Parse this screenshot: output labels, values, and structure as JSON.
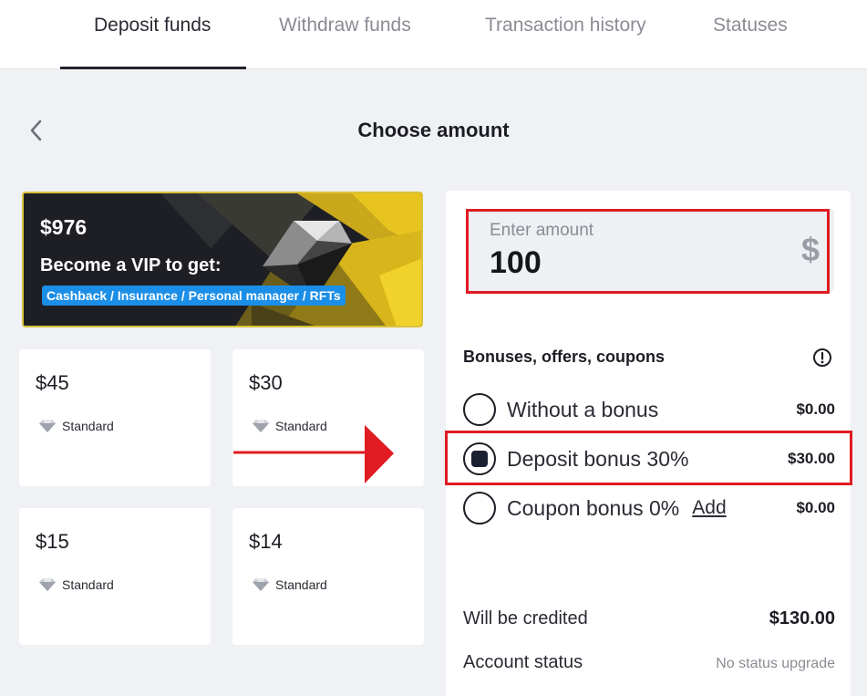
{
  "tabs": [
    {
      "label": "Deposit funds",
      "active": true
    },
    {
      "label": "Withdraw funds",
      "active": false
    },
    {
      "label": "Transaction history",
      "active": false
    },
    {
      "label": "Statuses",
      "active": false
    }
  ],
  "header": {
    "back_icon": "chevron-left-icon",
    "title": "Choose amount"
  },
  "vip": {
    "amount": "$976",
    "text": "Become a VIP to get:",
    "benefits": "Cashback / Insurance / Personal manager / RFTs"
  },
  "cards": [
    {
      "amount": "$45",
      "tier": "Standard",
      "icon": "diamond-icon"
    },
    {
      "amount": "$30",
      "tier": "Standard",
      "icon": "diamond-icon"
    },
    {
      "amount": "$15",
      "tier": "Standard",
      "icon": "diamond-icon"
    },
    {
      "amount": "$14",
      "tier": "Standard",
      "icon": "diamond-icon"
    }
  ],
  "amount_input": {
    "label": "Enter amount",
    "value": "100",
    "currency_symbol": "$"
  },
  "bonuses": {
    "title": "Bonuses, offers, coupons",
    "info_icon": "exclamation-circle-icon",
    "options": [
      {
        "label": "Without a bonus",
        "value": "$0.00",
        "checked": false
      },
      {
        "label": "Deposit bonus 30%",
        "value": "$30.00",
        "checked": true
      },
      {
        "label": "Coupon bonus 0%",
        "link": "Add",
        "value": "$0.00",
        "checked": false
      }
    ]
  },
  "summary": {
    "credited_label": "Will be credited",
    "credited_value": "$130.00",
    "status_label": "Account status",
    "status_value": "No status upgrade"
  },
  "colors": {
    "highlight": "#e01b22",
    "vip_chip": "#1b8ee8",
    "vip_gold": "#e8c51e",
    "background": "#f0f1f4"
  }
}
